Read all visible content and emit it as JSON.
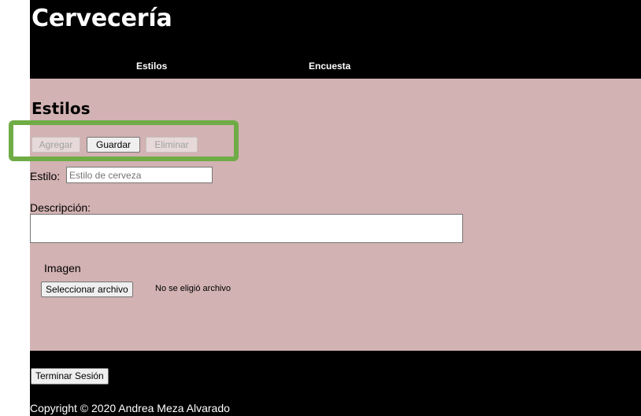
{
  "header": {
    "site_title": "Cervecería",
    "nav": [
      {
        "label": "Estilos"
      },
      {
        "label": "Encuesta"
      }
    ]
  },
  "main": {
    "section_title": "Estilos",
    "toolbar": {
      "agregar_label": "Agregar",
      "guardar_label": "Guardar",
      "eliminar_label": "Eliminar"
    },
    "form": {
      "estilo_label": "Estilo:",
      "estilo_value": "",
      "estilo_placeholder": "Estilo de cerveza",
      "descripcion_label": "Descripción:",
      "descripcion_value": "",
      "imagen_label": "Imagen",
      "file_button_label": "Seleccionar archivo",
      "file_status": "No se eligió archivo"
    }
  },
  "footer": {
    "logout_label": "Terminar Sesión",
    "copyright": "Copyright © 2020 Andrea Meza Alvarado"
  },
  "colors": {
    "header_bg": "#000000",
    "main_bg": "#d2b2b2",
    "highlight": "#6fac46"
  }
}
